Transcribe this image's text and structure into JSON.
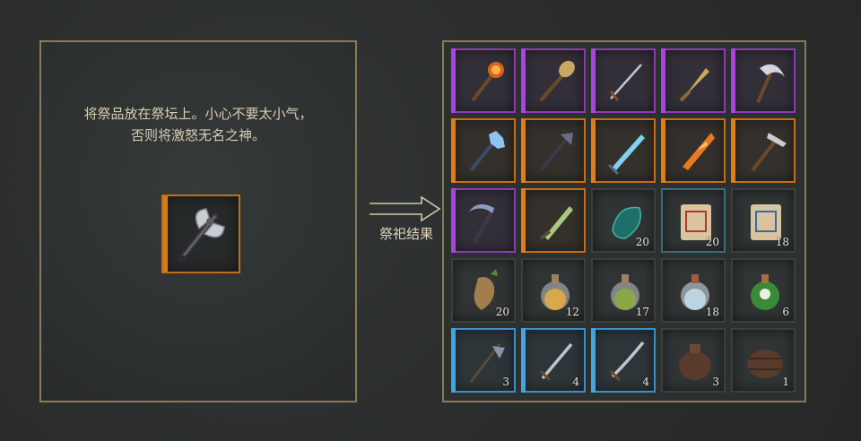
{
  "altar": {
    "instruction_line1": "将祭品放在祭坛上。小心不要太小气，",
    "instruction_line2": "否则将激怒无名之神。",
    "offering": {
      "name": "battle-axe-icon",
      "rarity": "legendary"
    }
  },
  "result_label": "祭祀结果",
  "colors": {
    "epic": "#a844e0",
    "legendary": "#e07d18",
    "rare": "#44a4e0",
    "panel_border": "#8a7a5c"
  },
  "inventory": {
    "rows": [
      [
        {
          "name": "fire-mace-icon",
          "rarity": "epic",
          "qty": ""
        },
        {
          "name": "gold-mace-icon",
          "rarity": "epic",
          "qty": ""
        },
        {
          "name": "rapier-icon",
          "rarity": "epic",
          "qty": ""
        },
        {
          "name": "golden-dagger-icon",
          "rarity": "epic",
          "qty": ""
        },
        {
          "name": "silver-axe-icon",
          "rarity": "epic",
          "qty": ""
        }
      ],
      [
        {
          "name": "ice-mace-icon",
          "rarity": "legendary",
          "qty": ""
        },
        {
          "name": "dark-scepter-icon",
          "rarity": "legendary",
          "qty": ""
        },
        {
          "name": "ice-sword-icon",
          "rarity": "legendary",
          "qty": ""
        },
        {
          "name": "flame-sword-icon",
          "rarity": "legendary",
          "qty": ""
        },
        {
          "name": "war-pick-icon",
          "rarity": "legendary",
          "qty": ""
        }
      ],
      [
        {
          "name": "scythe-icon",
          "rarity": "epic",
          "qty": ""
        },
        {
          "name": "nature-dagger-icon",
          "rarity": "legendary",
          "qty": ""
        },
        {
          "name": "teal-gem-icon",
          "rarity": "plain",
          "qty": "20"
        },
        {
          "name": "red-scroll-icon",
          "rarity": "teal",
          "qty": "20"
        },
        {
          "name": "blue-scroll-icon",
          "rarity": "plain",
          "qty": "18"
        }
      ],
      [
        {
          "name": "mandrake-root-icon",
          "rarity": "plain",
          "qty": "20"
        },
        {
          "name": "yellow-potion-icon",
          "rarity": "plain",
          "qty": "12"
        },
        {
          "name": "green-potion-icon",
          "rarity": "plain",
          "qty": "17"
        },
        {
          "name": "clear-potion-icon",
          "rarity": "plain",
          "qty": "18"
        },
        {
          "name": "poison-flask-icon",
          "rarity": "plain",
          "qty": "6"
        }
      ],
      [
        {
          "name": "halberd-icon",
          "rarity": "rare",
          "qty": "3"
        },
        {
          "name": "longsword-icon",
          "rarity": "rare",
          "qty": "4"
        },
        {
          "name": "saber-icon",
          "rarity": "rare",
          "qty": "4"
        },
        {
          "name": "clay-jug-icon",
          "rarity": "plain",
          "qty": "3"
        },
        {
          "name": "barrel-icon",
          "rarity": "plain",
          "qty": "1"
        }
      ]
    ]
  }
}
